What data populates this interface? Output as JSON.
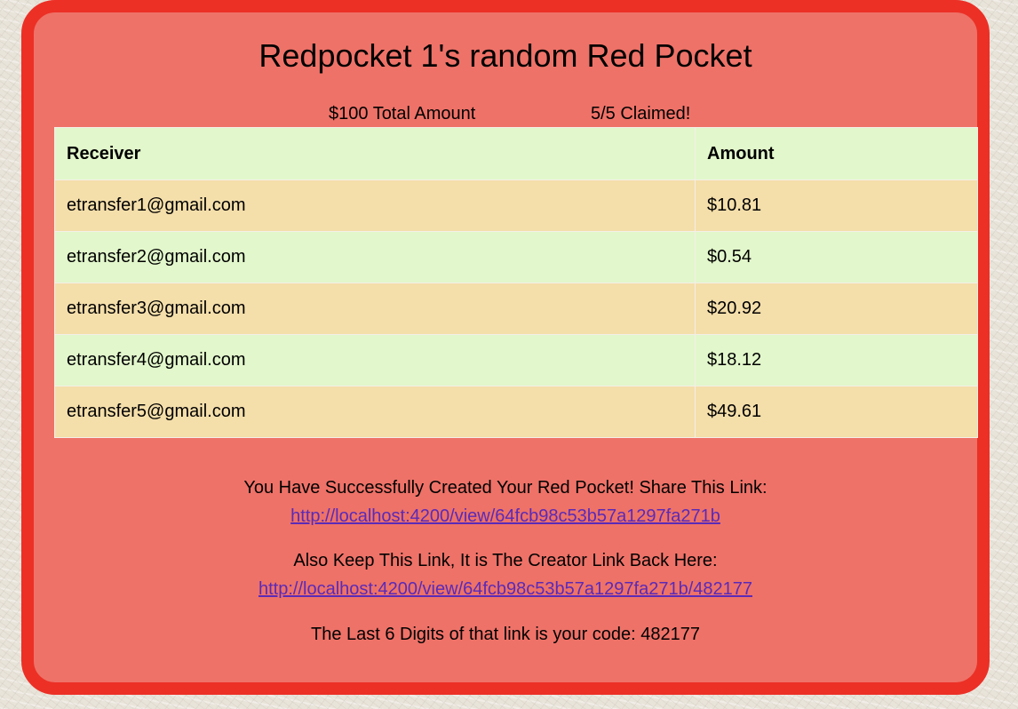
{
  "page": {
    "title": "Redpocket 1's random Red Pocket",
    "total_amount": "$100 Total Amount",
    "claimed": "5/5 Claimed!"
  },
  "table": {
    "headers": {
      "receiver": "Receiver",
      "amount": "Amount"
    },
    "rows": [
      {
        "receiver": "etransfer1@gmail.com",
        "amount": "$10.81"
      },
      {
        "receiver": "etransfer2@gmail.com",
        "amount": "$0.54"
      },
      {
        "receiver": "etransfer3@gmail.com",
        "amount": "$20.92"
      },
      {
        "receiver": "etransfer4@gmail.com",
        "amount": "$18.12"
      },
      {
        "receiver": "etransfer5@gmail.com",
        "amount": "$49.61"
      }
    ]
  },
  "share": {
    "message": "You Have Successfully Created Your Red Pocket! Share This Link:",
    "link": "http://localhost:4200/view/64fcb98c53b57a1297fa271b"
  },
  "creator": {
    "message": "Also Keep This Link, It is The Creator Link Back Here:",
    "link": "http://localhost:4200/view/64fcb98c53b57a1297fa271b/482177"
  },
  "code": {
    "message": "The Last 6 Digits of that link is your code: 482177"
  },
  "colors": {
    "card_background": "#ee7268",
    "card_border": "#ec3026",
    "row_green": "#e2f7cb",
    "row_tan": "#f4deaa",
    "link": "#5a2ab8"
  }
}
